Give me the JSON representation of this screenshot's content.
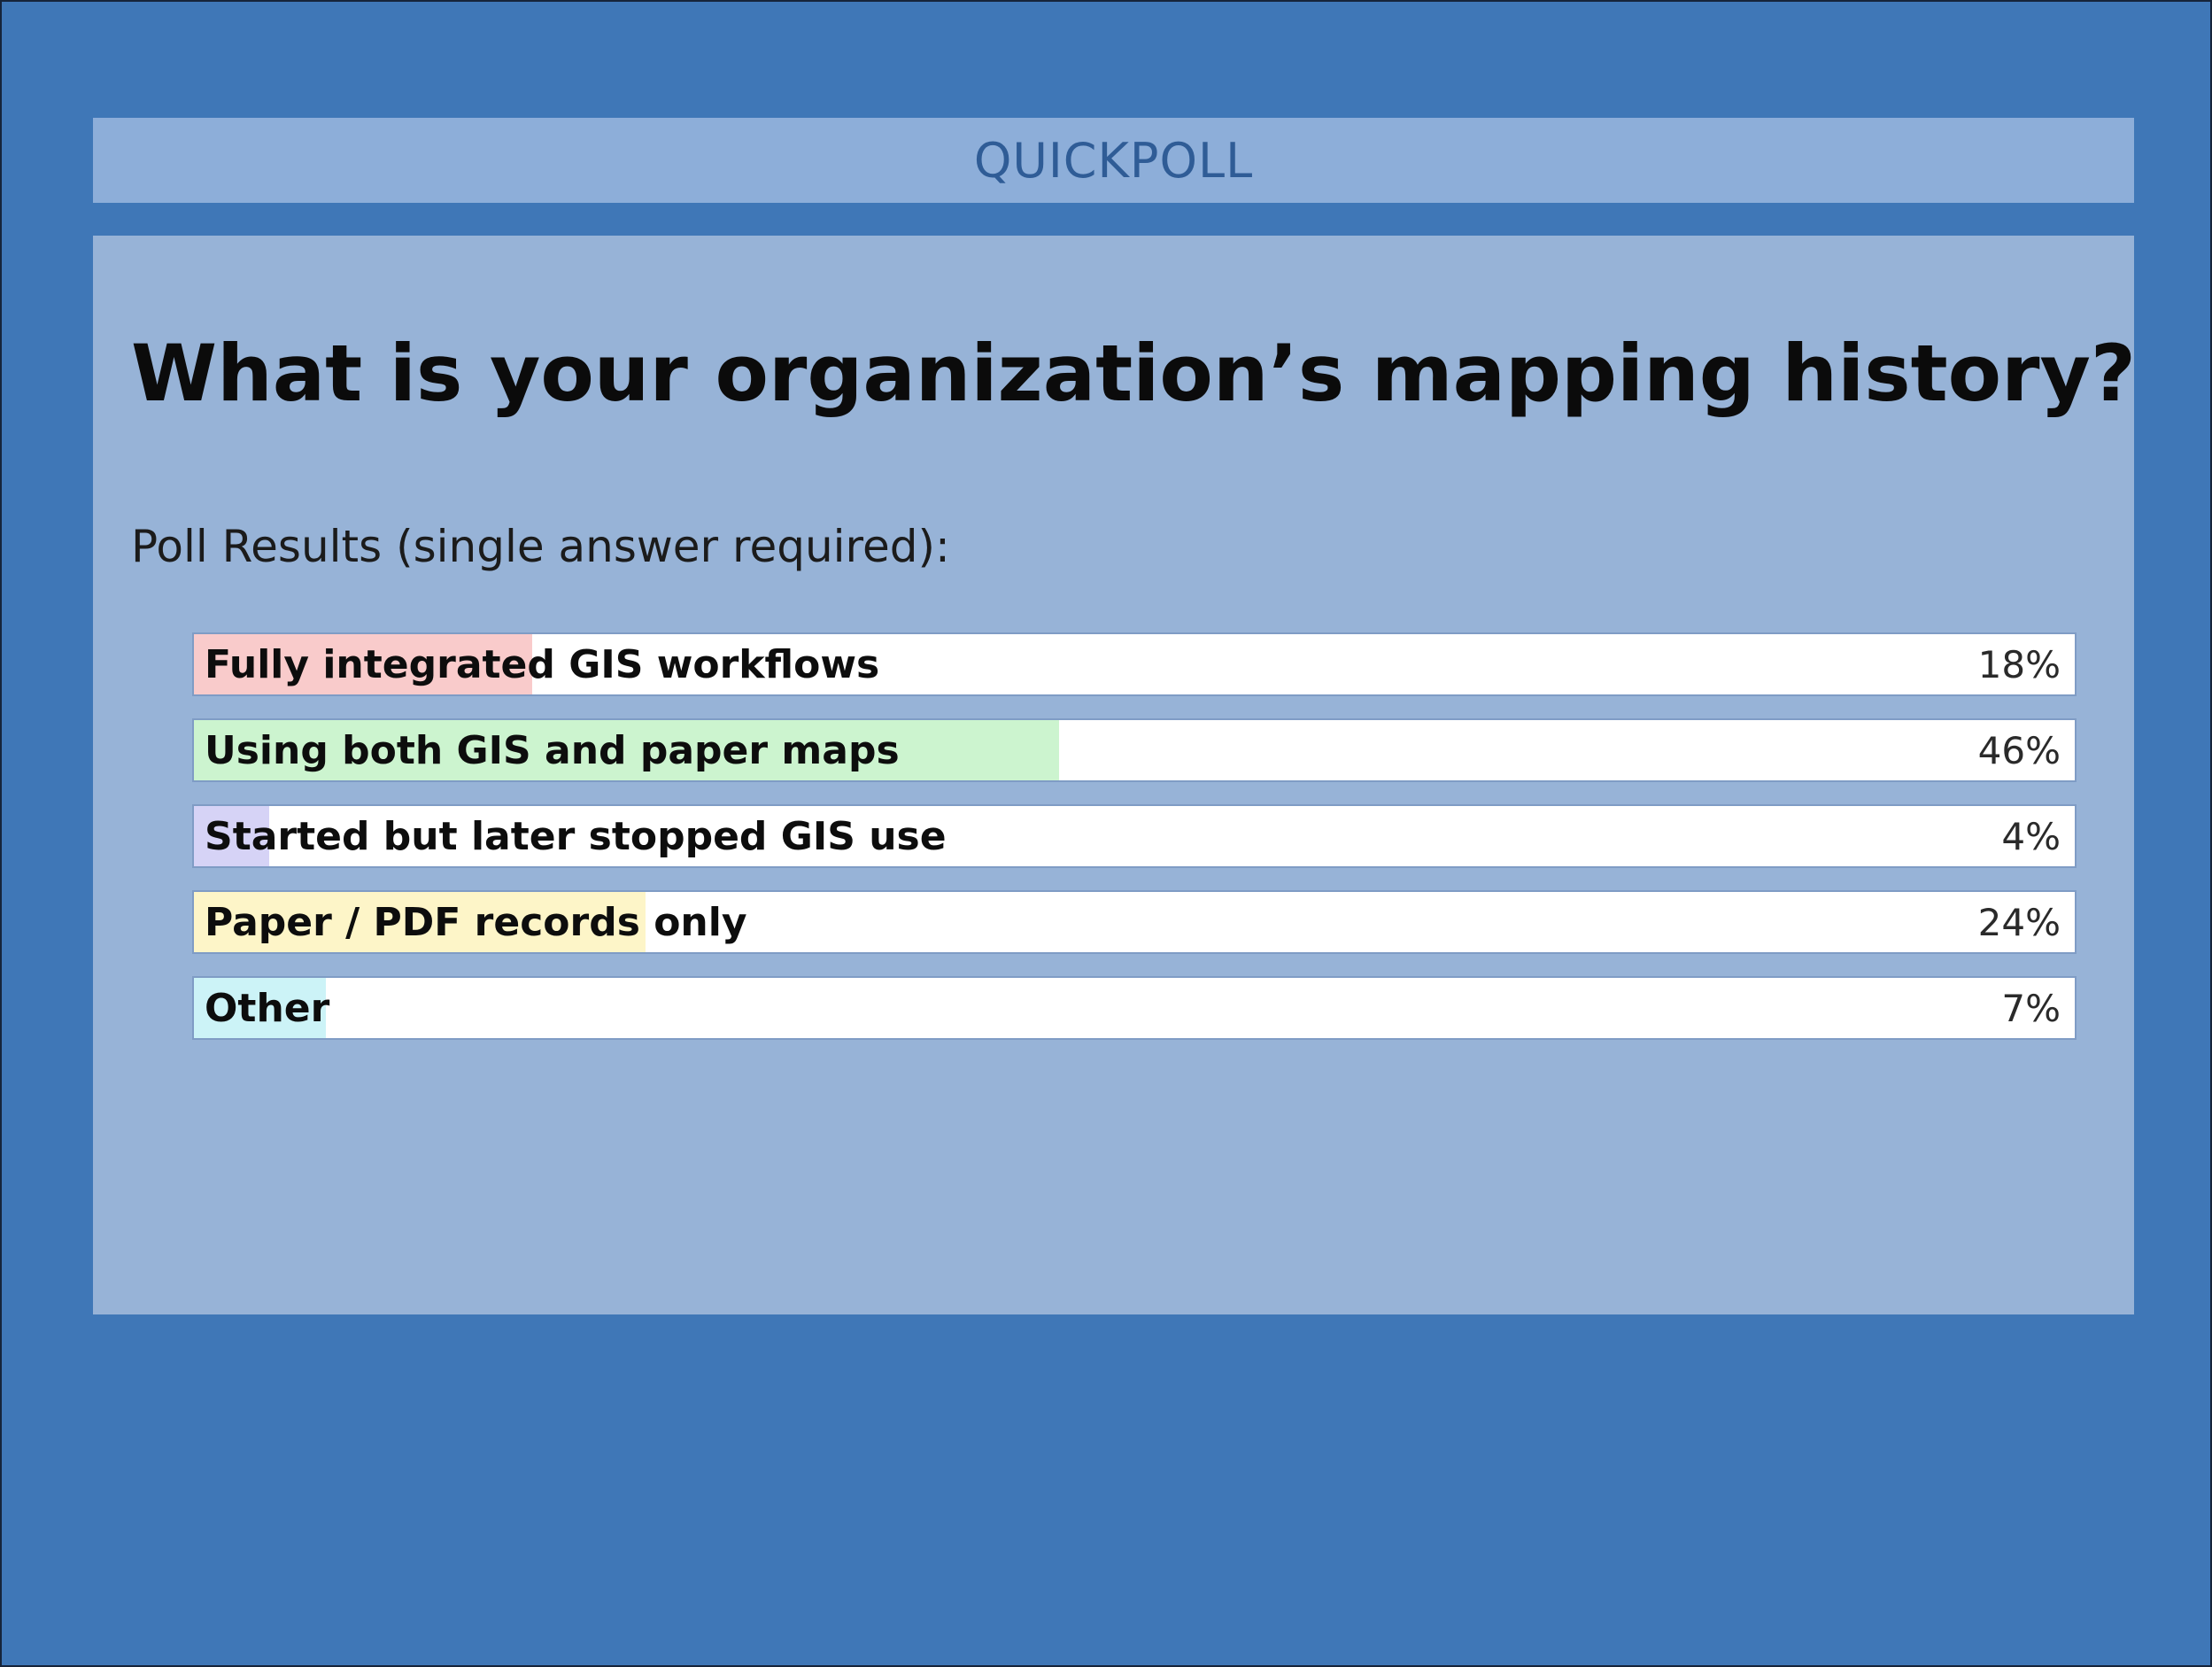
{
  "header": {
    "title": "QUICKPOLL"
  },
  "question": "What is your organization’s mapping history?",
  "subtitle": "Poll Results (single answer required):",
  "options": [
    {
      "label": "Fully integrated GIS workflows",
      "percent_text": "18%",
      "fill": 0.18,
      "color": "#f9cbcb"
    },
    {
      "label": "Using both GIS and paper maps",
      "percent_text": "46%",
      "fill": 0.46,
      "color": "#ccf4cf"
    },
    {
      "label": "Started but later stopped GIS use",
      "percent_text": "4%",
      "fill": 0.04,
      "color": "#d6d3f6"
    },
    {
      "label": "Paper / PDF records only",
      "percent_text": "24%",
      "fill": 0.24,
      "color": "#fdf5c8"
    },
    {
      "label": "Other",
      "percent_text": "7%",
      "fill": 0.07,
      "color": "#ccf3f7"
    }
  ]
}
